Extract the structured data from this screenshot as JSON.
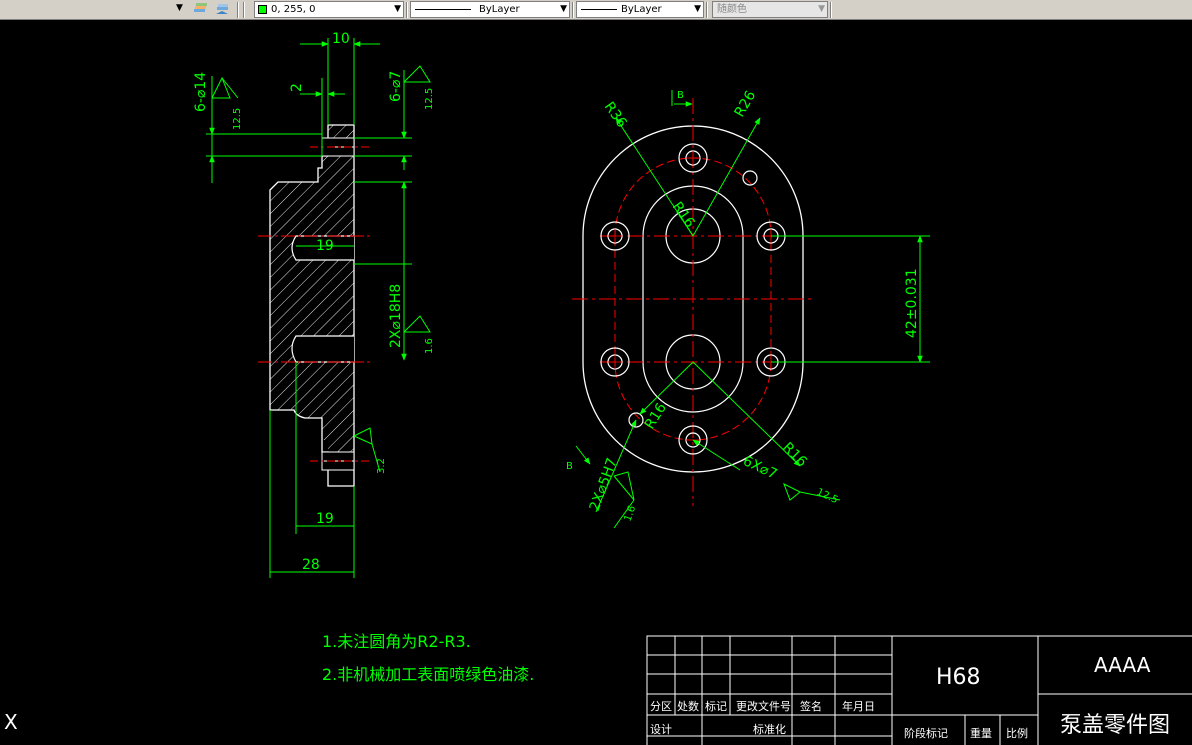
{
  "toolbar": {
    "color_value": "0, 255, 0",
    "linetype": "ByLayer",
    "lineweight": "ByLayer",
    "plotstyle": "随颜色"
  },
  "colors": {
    "dimension": "#00ff00",
    "outline": "#ffffff",
    "centerline": "#ff0000",
    "annotation": "#ffff00",
    "hatch": "#ffffff",
    "background": "#000000"
  },
  "side_view": {
    "dims": {
      "top_width": "10",
      "step": "2",
      "hole_14": "6-⌀14",
      "hole_7": "6-⌀7",
      "rough_12_5_a": "12.5",
      "rough_12_5_b": "12.5",
      "depth_19_upper": "19",
      "bore": "2X⌀18H8",
      "rough_1_6": "1.6",
      "rough_3_2": "3.2",
      "depth_19_lower": "19",
      "overall_28": "28"
    }
  },
  "front_view": {
    "dims": {
      "section_b_top": "B",
      "section_b_bottom": "B",
      "r36": "R36",
      "r26": "R26",
      "r16_center": "R16",
      "r16_left": "R16",
      "r16_right": "R16",
      "center_dist": "42±0.031",
      "pin_holes": "2X⌀5H7",
      "rough_1_6": "1.6",
      "holes_6x7": "6X⌀7",
      "rough_12_5": "12.5"
    }
  },
  "notes": {
    "line1": "1.未注圆角为R2-R3.",
    "line2": "2.非机械加工表面喷绿色油漆."
  },
  "title_block": {
    "material": "H68",
    "company": "AAAA",
    "part_name": "泵盖零件图",
    "headers": [
      "分区",
      "处数",
      "标记",
      "更改文件号",
      "签名",
      "年月日"
    ],
    "design": "设计",
    "standard": "标准化",
    "stage_mark": "阶段标记",
    "weight": "重量",
    "scale": "比例"
  },
  "ucs_label": "X"
}
